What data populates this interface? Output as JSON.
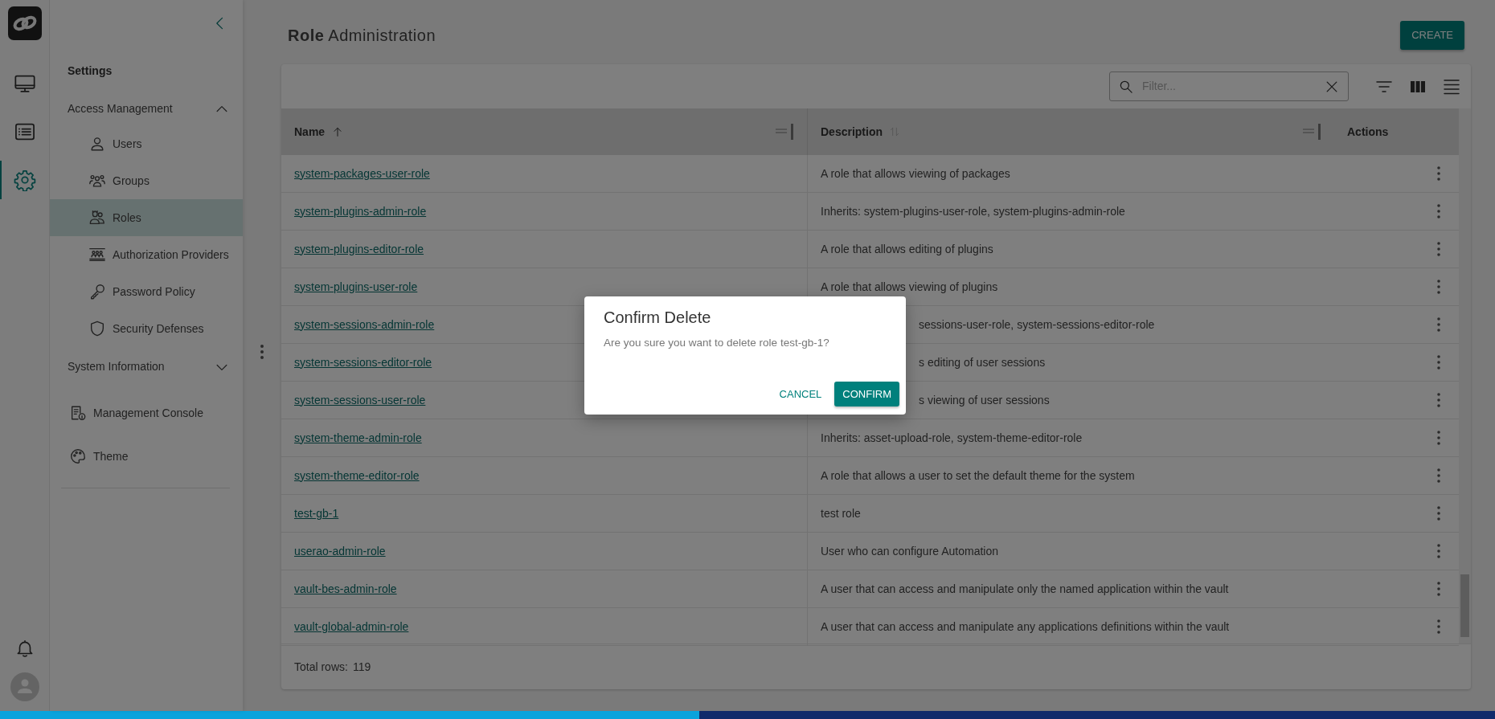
{
  "rail_items": [
    {
      "kind": "monitor",
      "selected": false
    },
    {
      "kind": "list",
      "selected": false
    },
    {
      "kind": "settings",
      "selected": true
    }
  ],
  "sidebar": {
    "title": "Settings",
    "items": [
      {
        "kind": "section",
        "label": "Access Management",
        "expanded": true,
        "children": [
          {
            "kind": "user",
            "label": "Users",
            "selected": false
          },
          {
            "kind": "group",
            "label": "Groups",
            "selected": false
          },
          {
            "kind": "role",
            "label": "Roles",
            "selected": true
          },
          {
            "kind": "providers",
            "label": "Authorization Providers",
            "selected": false
          },
          {
            "kind": "key",
            "label": "Password Policy",
            "selected": false
          },
          {
            "kind": "shield",
            "label": "Security Defenses",
            "selected": false
          }
        ]
      },
      {
        "kind": "section",
        "label": "System Information",
        "expanded": false
      },
      {
        "kind": "console",
        "label": "Management Console",
        "selected": false
      },
      {
        "kind": "palette",
        "label": "Theme",
        "selected": false
      }
    ]
  },
  "page": {
    "title_bold": "Role",
    "title_rest": "Administration",
    "create_button": "CREATE"
  },
  "filter": {
    "placeholder": "Filter..."
  },
  "table": {
    "columns": [
      {
        "label": "Name",
        "kind": "ascending"
      },
      {
        "label": "Description",
        "kind": "unsorted"
      },
      {
        "label": "Actions",
        "kind": "plain"
      }
    ],
    "rows": [
      {
        "kind": "full",
        "name": "system-packages-user-role",
        "description": "A role that allows viewing of packages"
      },
      {
        "kind": "full",
        "name": "system-plugins-admin-role",
        "description": "Inherits: system-plugins-user-role, system-plugins-admin-role"
      },
      {
        "kind": "full",
        "name": "system-plugins-editor-role",
        "description": "A role that allows editing of plugins"
      },
      {
        "kind": "full",
        "name": "system-plugins-user-role",
        "description": "A role that allows viewing of plugins"
      },
      {
        "kind": "partial",
        "name": "system-sessions-admin-role",
        "description": "sessions-user-role, system-sessions-editor-role"
      },
      {
        "kind": "partial",
        "name": "system-sessions-editor-role",
        "description": "s editing of user sessions"
      },
      {
        "kind": "partial",
        "name": "system-sessions-user-role",
        "description": "s viewing of user sessions"
      },
      {
        "kind": "full",
        "name": "system-theme-admin-role",
        "description": "Inherits: asset-upload-role, system-theme-editor-role"
      },
      {
        "kind": "full",
        "name": "system-theme-editor-role",
        "description": "A role that allows a user to set the default theme for the system"
      },
      {
        "kind": "full",
        "name": "test-gb-1",
        "description": "test role"
      },
      {
        "kind": "full",
        "name": "userao-admin-role",
        "description": "User who can configure Automation"
      },
      {
        "kind": "full",
        "name": "vault-bes-admin-role",
        "description": "A user that can access and manipulate only the named application within the vault"
      },
      {
        "kind": "full",
        "name": "vault-global-admin-role",
        "description": "A user that can access and manipulate any applications definitions within the vault"
      }
    ],
    "footer_label": "Total rows:",
    "footer_count": "119"
  },
  "dialog": {
    "title": "Confirm Delete",
    "message": "Are you sure you want to delete role test-gb-1?",
    "cancel": "CANCEL",
    "confirm": "CONFIRM"
  }
}
